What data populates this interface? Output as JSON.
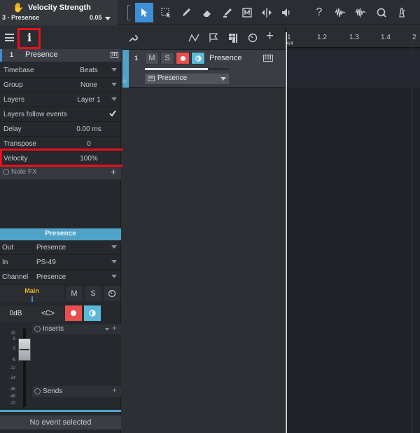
{
  "top": {
    "title": "Velocity Strength",
    "subtitle": "3 - Presence",
    "value": "0.05"
  },
  "inspector": {
    "track_number": "1",
    "track_name": "Presence",
    "rows": [
      {
        "label": "Timebase",
        "value": "Beats"
      },
      {
        "label": "Group",
        "value": "None"
      },
      {
        "label": "Layers",
        "value": "Layer 1"
      },
      {
        "label": "Layers follow events",
        "value": ""
      },
      {
        "label": "Delay",
        "value": "0.00 ms"
      },
      {
        "label": "Transpose",
        "value": "0"
      },
      {
        "label": "Velocity",
        "value": "100%"
      }
    ],
    "note_fx": "Note FX"
  },
  "channel": {
    "name": "Presence",
    "out_label": "Out",
    "out_value": "Presence",
    "in_label": "In",
    "in_value": "PS-49",
    "channel_label": "Channel",
    "channel_value": "Presence",
    "main_label": "Main",
    "m": "M",
    "s": "S",
    "gain": "0dB",
    "pan": "<C>",
    "inserts": "Inserts",
    "sends": "Sends",
    "meter_ticks": [
      "10",
      "6",
      "0",
      "-6",
      "-12",
      "-24",
      "-36",
      "-48",
      "-72"
    ]
  },
  "status": "No event selected",
  "track": {
    "number": "1",
    "m": "M",
    "s": "S",
    "name": "Presence",
    "instrument": "Presence",
    "volume": 0.75
  },
  "ruler": {
    "marks": [
      "1",
      "1.2",
      "1.3",
      "1.4",
      "2"
    ],
    "time_signature": "4/4"
  },
  "colors": {
    "accent": "#3d8fd6",
    "record": "#e8504f",
    "monitor": "#5bb8d6",
    "highlight": "#e8101c",
    "channel_header": "#4fa3c8"
  }
}
